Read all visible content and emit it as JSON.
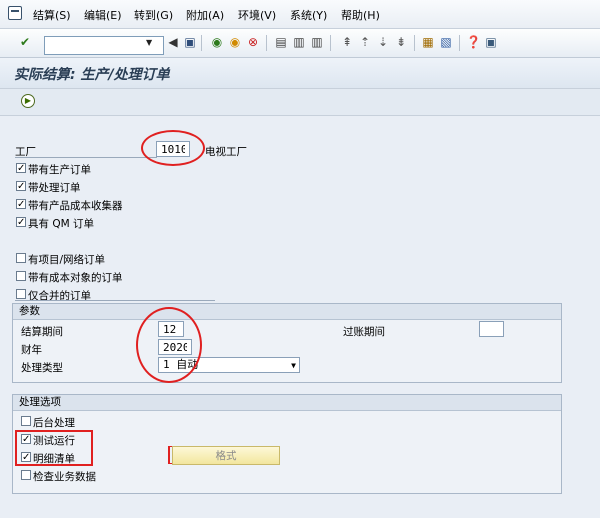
{
  "menu": {
    "items": [
      "结算(S)",
      "编辑(E)",
      "转到(G)",
      "附加(A)",
      "环境(V)",
      "系统(Y)",
      "帮助(H)"
    ]
  },
  "toolbar": {
    "command_value": "",
    "icons": [
      "enter-icon",
      "back-icon",
      "save-icon",
      "exit-icon",
      "cancel-icon",
      "print-icon",
      "find-icon",
      "find-next-icon",
      "first-page-icon",
      "prev-page-icon",
      "next-page-icon",
      "last-page-icon",
      "new-session-icon",
      "shortcut-icon",
      "help-icon",
      "layout-icon"
    ]
  },
  "title": "实际结算: 生产/处理订单",
  "selection": {
    "plant_label": "工厂",
    "plant_value": "1010",
    "plant_desc": "电视工厂",
    "checkboxes": [
      {
        "label": "带有生产订单",
        "checked": true
      },
      {
        "label": "带处理订单",
        "checked": true
      },
      {
        "label": "带有产品成本收集器",
        "checked": true
      },
      {
        "label": "具有 QM 订单",
        "checked": true
      },
      {
        "label": "有项目/网络订单",
        "checked": false
      },
      {
        "label": "带有成本对象的订单",
        "checked": false
      },
      {
        "label": "仅合并的订单",
        "checked": false
      }
    ]
  },
  "params": {
    "header": "参数",
    "period_label": "结算期间",
    "period_value": "12",
    "year_label": "财年",
    "year_value": "2020",
    "type_label": "处理类型",
    "type_value": "1 自动",
    "posting_label": "过账期间",
    "posting_value": ""
  },
  "options": {
    "header": "处理选项",
    "checkboxes": [
      {
        "label": "后台处理",
        "checked": false
      },
      {
        "label": "测试运行",
        "checked": true
      },
      {
        "label": "明细清单",
        "checked": true
      },
      {
        "label": "检查业务数据",
        "checked": false
      }
    ],
    "layout_button": "格式"
  }
}
